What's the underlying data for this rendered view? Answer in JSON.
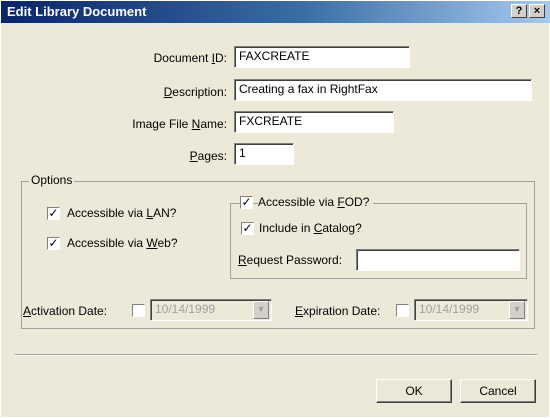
{
  "window": {
    "title": "Edit Library Document",
    "help_label": "?",
    "close_label": "×"
  },
  "fields": {
    "document_id": {
      "label": "Document ID:",
      "value": "FAXCREATE"
    },
    "description": {
      "label": "Description:",
      "value": "Creating a fax in RightFax"
    },
    "image_file_name": {
      "label": "Image File Name:",
      "value": "FXCREATE"
    },
    "pages": {
      "label": "Pages:",
      "value": "1"
    }
  },
  "options": {
    "group_label": "Options",
    "accessible_lan": {
      "label": "Accessible via LAN?",
      "checked": true
    },
    "accessible_web": {
      "label": "Accessible via Web?",
      "checked": true
    },
    "accessible_fod": {
      "label": "Accessible via FOD?",
      "checked": true
    },
    "include_catalog": {
      "label": "Include in Catalog?",
      "checked": true
    },
    "request_password": {
      "label": "Request Password:",
      "value": ""
    },
    "activation_date": {
      "label": "Activation Date:",
      "value": "10/14/1999",
      "checked": false
    },
    "expiration_date": {
      "label": "Expiration Date:",
      "value": "10/14/1999",
      "checked": false
    }
  },
  "buttons": {
    "ok": "OK",
    "cancel": "Cancel"
  },
  "icons": {
    "check": "✓",
    "dropdown": "▼"
  }
}
